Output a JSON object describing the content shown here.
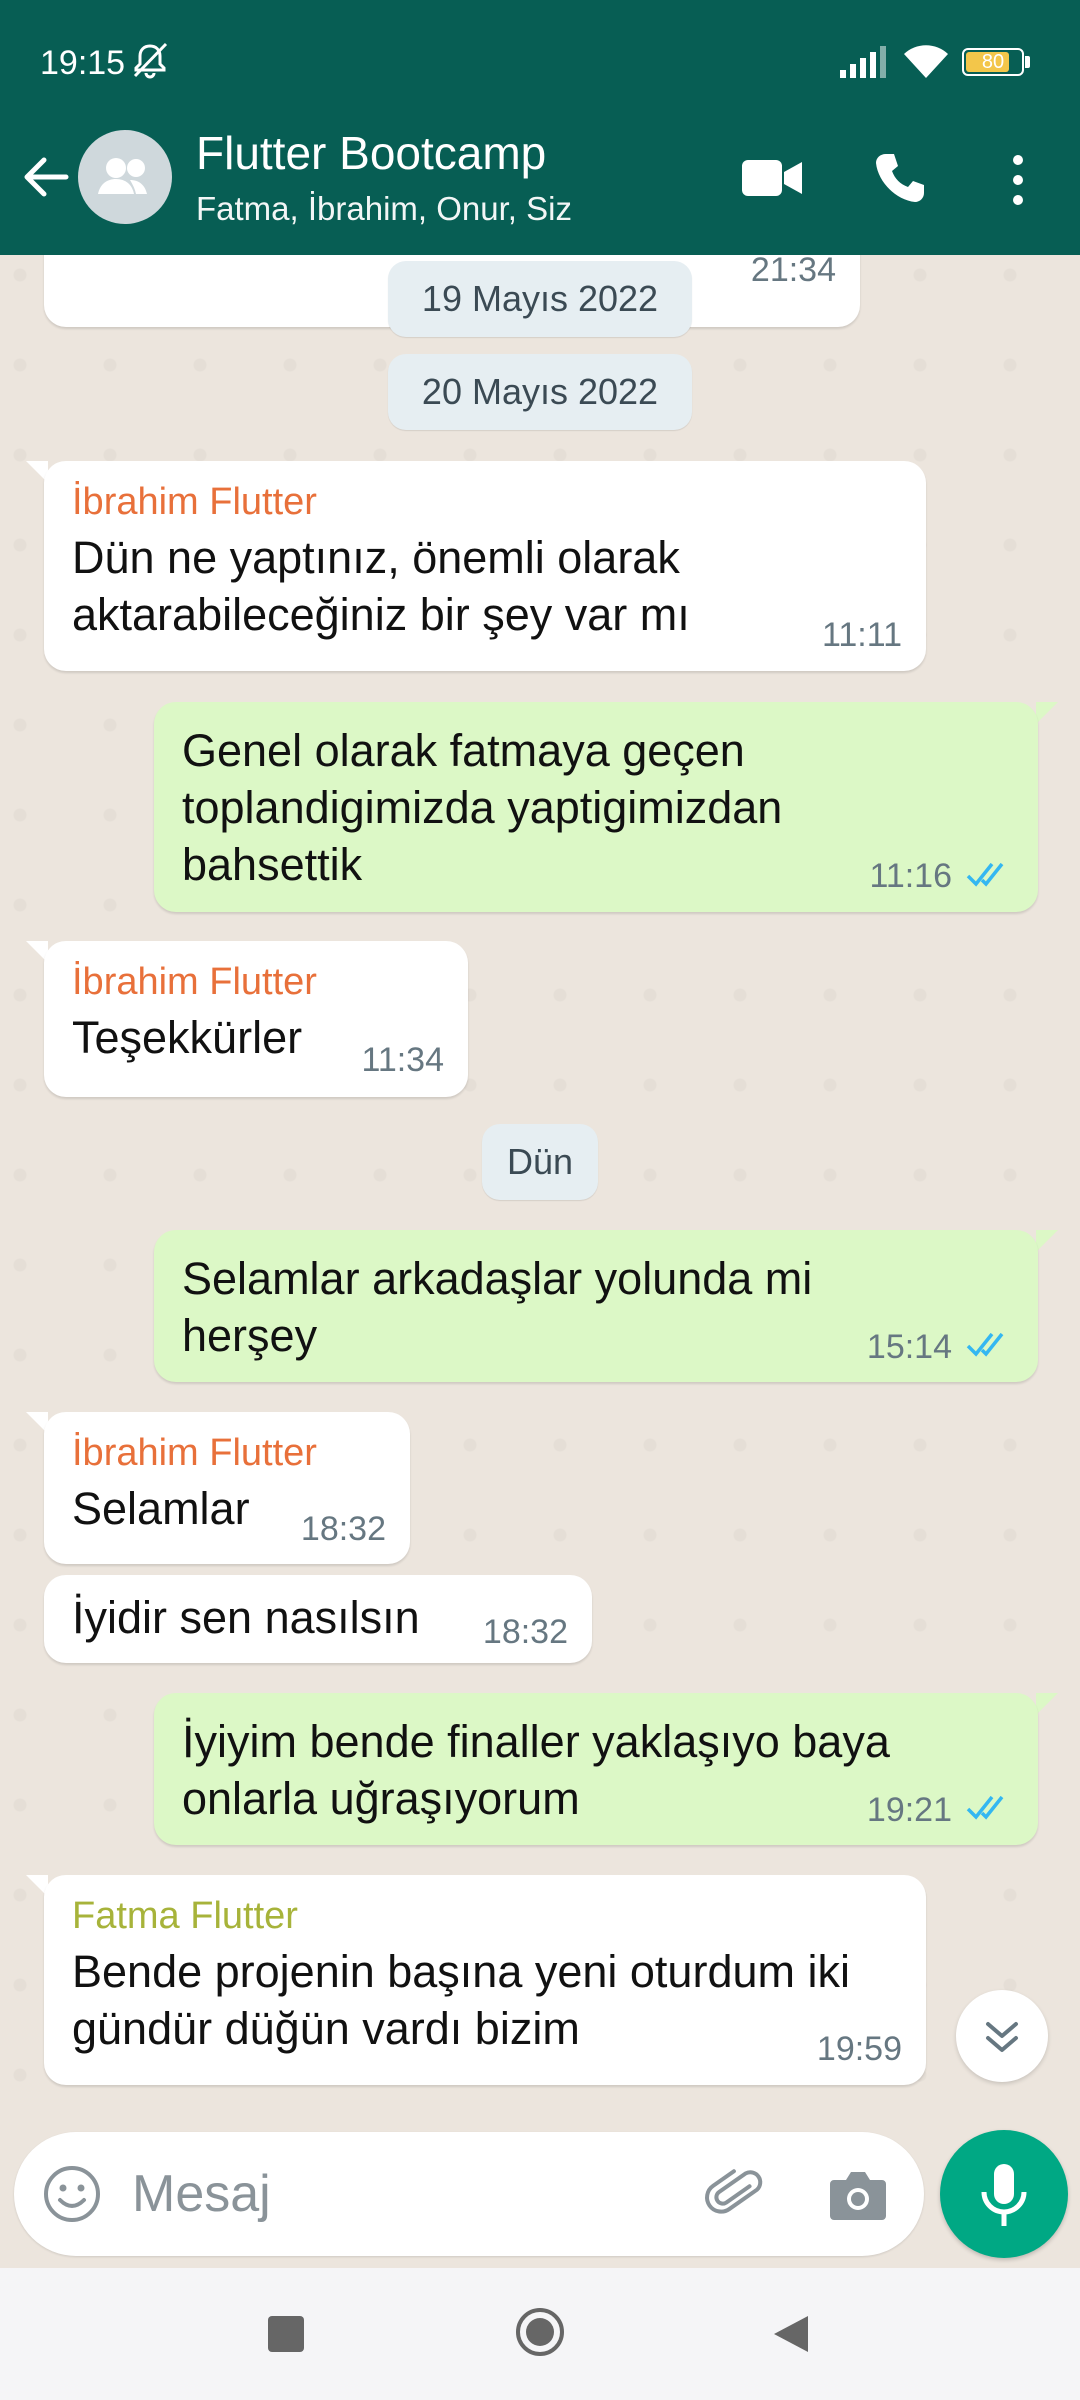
{
  "status_bar": {
    "time": "19:15",
    "battery": "80",
    "battery_fraction": 0.8
  },
  "header": {
    "title": "Flutter Bootcamp",
    "subtitle": "Fatma, İbrahim, Onur, Siz"
  },
  "colors": {
    "header_bg": "#075E54",
    "outgoing_bubble": "#DCF8C6",
    "incoming_bubble": "#FFFFFF",
    "sender_ibrahim": "#E8703A",
    "sender_fatma": "#A7B33A",
    "read_ticks": "#34B7F1",
    "mic_button": "#00A884"
  },
  "messages": {
    "m0_time": "21:34",
    "date1": "19 Mayıs 2022",
    "date2": "20 Mayıs 2022",
    "m1": {
      "sender": "İbrahim Flutter",
      "line1": "Dün ne yaptınız, önemli olarak",
      "line2": "aktarabileceğiniz bir şey var mı",
      "time": "11:11"
    },
    "m2": {
      "line1": "Genel olarak fatmaya geçen",
      "line2": "toplandigimizda yaptigimizdan",
      "line3": "bahsettik",
      "time": "11:16"
    },
    "m3": {
      "sender": "İbrahim Flutter",
      "text": "Teşekkürler",
      "time": "11:34"
    },
    "date3": "Dün",
    "m4": {
      "line1": "Selamlar arkadaşlar yolunda mi",
      "line2": "herşey",
      "time": "15:14"
    },
    "m5": {
      "sender": "İbrahim Flutter",
      "text": "Selamlar",
      "time": "18:32"
    },
    "m6": {
      "text": "İyidir sen nasılsın",
      "time": "18:32"
    },
    "m7": {
      "line1": "İyiyim bende finaller yaklaşıyo baya",
      "line2": "onlarla uğraşıyorum",
      "time": "19:21"
    },
    "m8": {
      "sender": "Fatma Flutter",
      "line1": "Bende projenin başına yeni oturdum iki",
      "line2": "gündür düğün vardı bizim",
      "time": "19:59"
    }
  },
  "composer": {
    "placeholder": "Mesaj"
  },
  "icons": [
    "mute-icon",
    "signal-icon",
    "wifi-icon",
    "battery-icon",
    "back-arrow-icon",
    "group-avatar-icon",
    "video-call-icon",
    "phone-icon",
    "more-vert-icon",
    "double-check-icon",
    "chevron-double-down-icon",
    "emoji-icon",
    "attach-icon",
    "camera-icon",
    "mic-icon",
    "nav-recents-icon",
    "nav-home-icon",
    "nav-back-icon"
  ]
}
